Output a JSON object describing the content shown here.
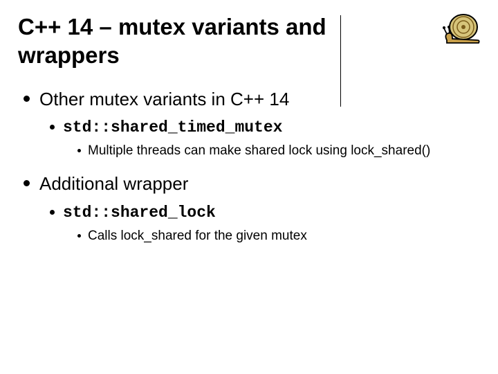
{
  "title": "C++ 14 – mutex variants and wrappers",
  "section1": {
    "heading": "Other mutex variants in C++ 14",
    "item": "std::shared_timed_mutex",
    "detail_a": "Multiple threads can make shared lock using ",
    "detail_b": "lock_shared()"
  },
  "section2": {
    "heading": "Additional wrapper",
    "item": "std::shared_lock",
    "detail_a": "Calls ",
    "detail_b": "lock_shared",
    "detail_c": " for the given mutex"
  }
}
